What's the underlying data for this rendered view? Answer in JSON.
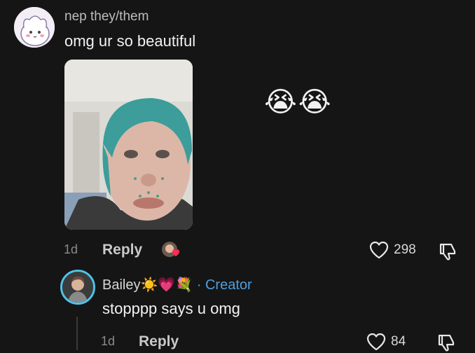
{
  "comment": {
    "username": "nep they/them",
    "text": "omg ur so beautiful",
    "emoji": "😭😭",
    "time": "1d",
    "reply_label": "Reply",
    "likes": "298"
  },
  "reply": {
    "username": "Bailey☀️💗💐",
    "creator_label": "· Creator",
    "text": "stopppp says u omg",
    "time": "1d",
    "reply_label": "Reply",
    "likes": "84"
  },
  "colors": {
    "background": "#151515",
    "creator_badge": "#4f9fe0",
    "avatar_ring": "#4fc3e8"
  }
}
